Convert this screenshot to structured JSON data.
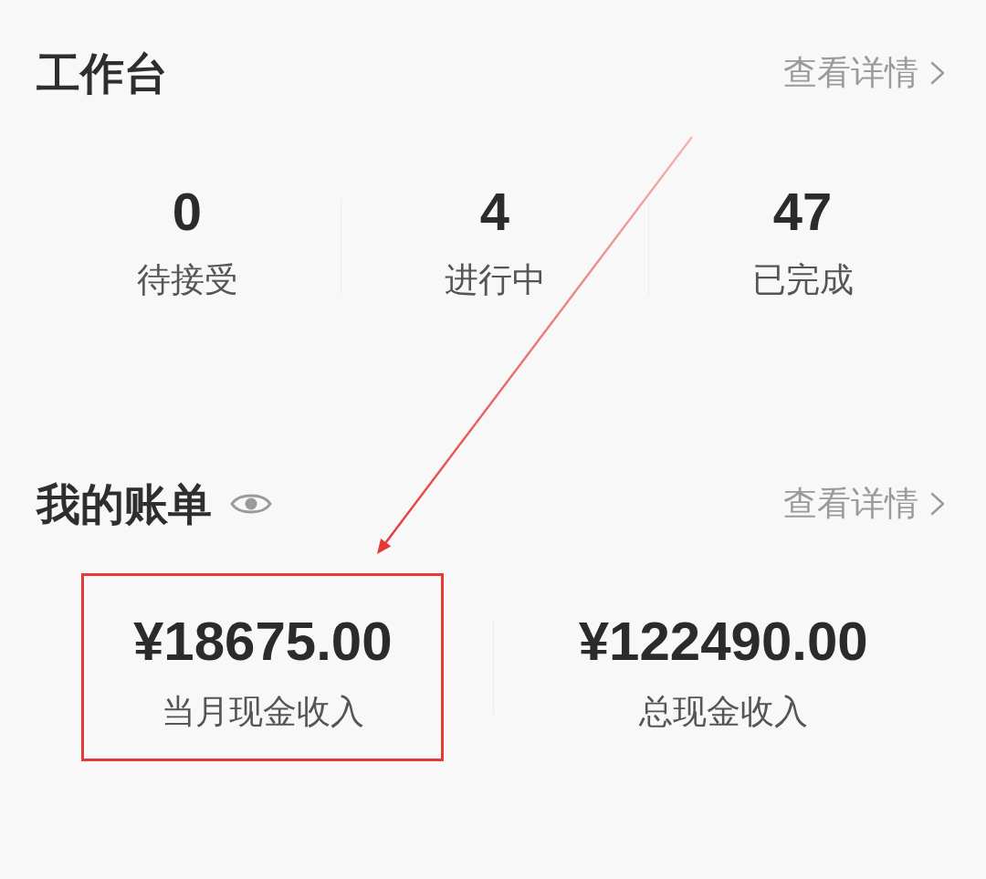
{
  "workbench": {
    "title": "工作台",
    "details_link": "查看详情",
    "stats": [
      {
        "value": "0",
        "label": "待接受"
      },
      {
        "value": "4",
        "label": "进行中"
      },
      {
        "value": "47",
        "label": "已完成"
      }
    ]
  },
  "bill": {
    "title": "我的账单",
    "details_link": "查看详情",
    "items": [
      {
        "amount": "¥18675.00",
        "label": "当月现金收入",
        "highlighted": true
      },
      {
        "amount": "¥122490.00",
        "label": "总现金收入",
        "highlighted": false
      }
    ]
  }
}
